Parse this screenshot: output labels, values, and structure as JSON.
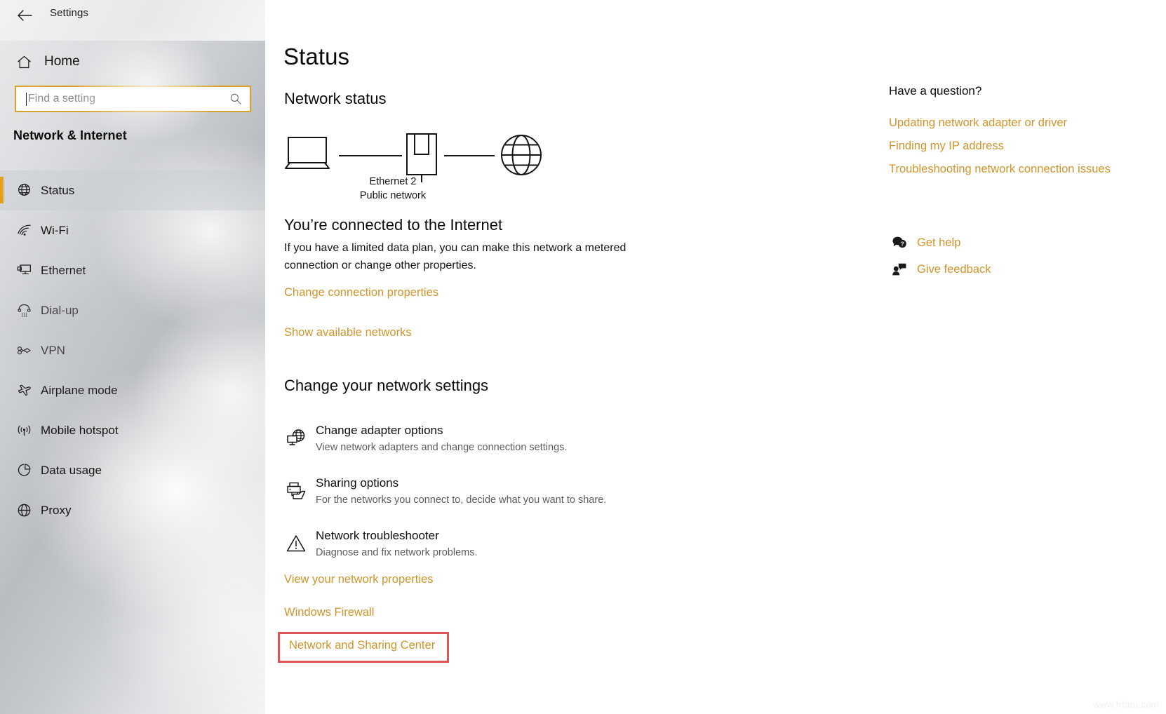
{
  "window": {
    "title": "Settings",
    "back_icon": "back-arrow-icon",
    "controls": [
      {
        "name": "minimize-button",
        "glyph": "—"
      },
      {
        "name": "maximize-button",
        "glyph": "□"
      },
      {
        "name": "close-button",
        "glyph": "✕"
      }
    ]
  },
  "sidebar": {
    "home_label": "Home",
    "home_icon": "home-icon",
    "search": {
      "value": "",
      "placeholder": "Find a setting",
      "icon": "search-icon"
    },
    "category_title": "Network & Internet",
    "selection_color": "#e3a01c",
    "items": [
      {
        "label": "Status",
        "icon": "globe-icon",
        "selected": true
      },
      {
        "label": "Wi-Fi",
        "icon": "wifi-icon",
        "selected": false
      },
      {
        "label": "Ethernet",
        "icon": "ethernet-icon",
        "selected": false
      },
      {
        "label": "Dial-up",
        "icon": "dialup-phone-icon",
        "selected": false
      },
      {
        "label": "VPN",
        "icon": "vpn-icon",
        "selected": false
      },
      {
        "label": "Airplane mode",
        "icon": "airplane-icon",
        "selected": false
      },
      {
        "label": "Mobile hotspot",
        "icon": "hotspot-icon",
        "selected": false
      },
      {
        "label": "Data usage",
        "icon": "pie-chart-icon",
        "selected": false
      },
      {
        "label": "Proxy",
        "icon": "globe-icon",
        "selected": false
      }
    ]
  },
  "main": {
    "page_title": "Status",
    "network_status_heading": "Network status",
    "diagram": {
      "device_icon": "laptop-icon",
      "adapter_icon": "ethernet-adapter-icon",
      "internet_icon": "globe-icon",
      "adapter_name": "Ethernet 2",
      "network_type": "Public network"
    },
    "connected_heading": "You’re connected to the Internet",
    "connected_description": "If you have a limited data plan, you can make this network a metered connection or change other properties.",
    "link_change_connection": "Change connection properties",
    "link_show_networks": "Show available networks",
    "change_settings_heading": "Change your network settings",
    "options": [
      {
        "title": "Change adapter options",
        "description": "View network adapters and change connection settings.",
        "icon": "network-adapter-icon"
      },
      {
        "title": "Sharing options",
        "description": "For the networks you connect to, decide what you want to share.",
        "icon": "sharing-printer-folder-icon"
      },
      {
        "title": "Network troubleshooter",
        "description": "Diagnose and fix network problems.",
        "icon": "warning-triangle-icon"
      }
    ],
    "link_view_properties": "View your network properties",
    "link_windows_firewall": "Windows Firewall",
    "link_network_sharing_center": "Network and Sharing Center",
    "highlight_color": "#e05353",
    "link_color": "#d0952a"
  },
  "right_panel": {
    "title": "Have a question?",
    "links": [
      "Updating network adapter or driver",
      "Finding my IP address",
      "Troubleshooting network connection issues"
    ],
    "actions": [
      {
        "label": "Get help",
        "icon": "help-chat-icon"
      },
      {
        "label": "Give feedback",
        "icon": "feedback-person-icon"
      }
    ]
  },
  "watermark": "www.frfam.com"
}
